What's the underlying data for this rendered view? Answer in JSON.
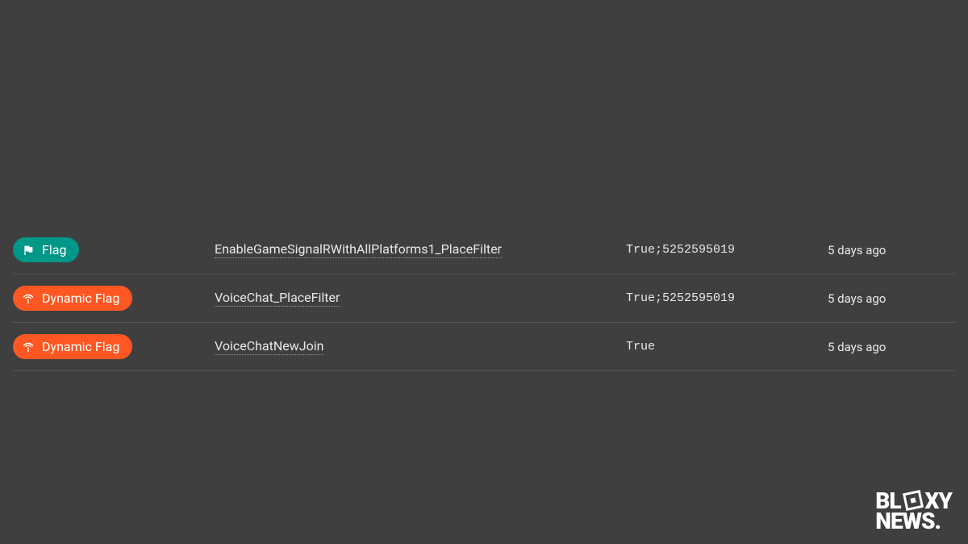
{
  "badges": {
    "flag": "Flag",
    "dynamic_flag": "Dynamic Flag"
  },
  "rows": [
    {
      "type": "flag",
      "name": "EnableGameSignalRWithAllPlatforms1_PlaceFilter",
      "value": "True;5252595019",
      "time": "5 days ago"
    },
    {
      "type": "dynamic",
      "name": "VoiceChat_PlaceFilter",
      "value": "True;5252595019",
      "time": "5 days ago"
    },
    {
      "type": "dynamic",
      "name": "VoiceChatNewJoin",
      "value": "True",
      "time": "5 days ago"
    }
  ],
  "logo": {
    "line1_pre": "BL",
    "line1_post": "XY",
    "line2": "NEWS."
  }
}
